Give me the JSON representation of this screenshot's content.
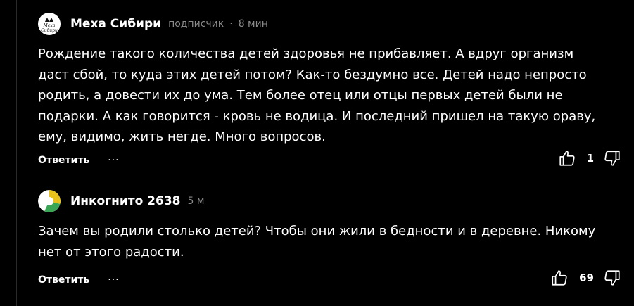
{
  "theme": {
    "background": "#000000",
    "text": "#ffffff",
    "muted": "#8a8a8a"
  },
  "comments": [
    {
      "author": "Меха Сибири",
      "avatar_text": "Меха Сибири",
      "role": "подписчик",
      "separator": "·",
      "time": "8 мин",
      "text": "Рождение такого количества детей здоровья не прибавляет. А вдруг организм даст сбой, то куда этих детей потом? Как-то бездумно все. Детей надо непросто родить, а довести их до ума. Тем более отец или отцы первых детей были не подарки. А как говорится - кровь не водица. И последний пришел на такую ораву, ему, видимо, жить негде. Много вопросов.",
      "reply_label": "Ответить",
      "more_label": "···",
      "likes": "1",
      "icons": {
        "like": "thumbs-up-icon",
        "dislike": "thumbs-down-icon",
        "more": "ellipsis-icon"
      }
    },
    {
      "author": "Инкогнито 2638",
      "time": "5 м",
      "text": "Зачем вы родили столько детей? Чтобы они жили в бедности и в деревне. Никому нет от этого радости.",
      "reply_label": "Ответить",
      "more_label": "···",
      "likes": "69",
      "avatar_colors": [
        "#e8c21a",
        "#3aa655",
        "#ffffff"
      ],
      "icons": {
        "like": "thumbs-up-icon",
        "dislike": "thumbs-down-icon",
        "more": "ellipsis-icon"
      }
    }
  ]
}
